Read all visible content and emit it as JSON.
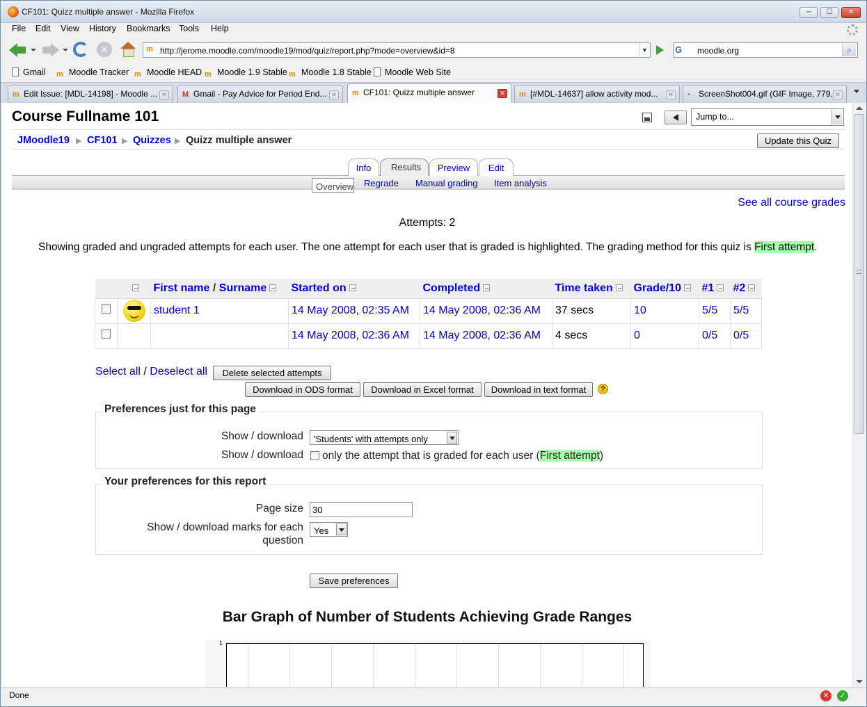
{
  "window": {
    "title": "CF101: Quizz multiple answer - Mozilla Firefox",
    "min": "─",
    "max": "☐",
    "close": "✕"
  },
  "menu": [
    "File",
    "Edit",
    "View",
    "History",
    "Bookmarks",
    "Tools",
    "Help"
  ],
  "nav": {
    "url": "http://jerome.moodle.com/moodle19/mod/quiz/report.php?mode=overview&id=8",
    "search_engine": "G",
    "search_value": "moodle.org"
  },
  "bookmarks": [
    "Gmail",
    "Moodle Tracker",
    "Moodle HEAD",
    "Moodle 1.9 Stable",
    "Moodle 1.8 Stable",
    "Moodle Web Site"
  ],
  "tabs": [
    {
      "label": "Edit Issue: [MDL-14198] - Moodle ..."
    },
    {
      "label": "Gmail - Pay Advice for Period End..."
    },
    {
      "label": "CF101: Quizz multiple answer"
    },
    {
      "label": "[#MDL-14637] allow activity mod..."
    },
    {
      "label": "ScreenShot004.gif (GIF Image, 779..."
    }
  ],
  "page": {
    "course_title": "Course Fullname 101",
    "jump_to": "Jump to...",
    "breadcrumb": [
      "JMoodle19",
      "CF101",
      "Quizzes",
      "Quizz multiple answer"
    ],
    "update_button": "Update this Quiz",
    "tabs": [
      "Info",
      "Results",
      "Preview",
      "Edit"
    ],
    "subtabs": [
      "Overview",
      "Regrade",
      "Manual grading",
      "Item analysis"
    ],
    "see_all": "See all course grades",
    "attempts": "Attempts: 2",
    "info_text": "Showing graded and ungraded attempts for each user. The one attempt for each user that is graded is highlighted. The grading method for this quiz is ",
    "grading_method": "First attempt",
    "info_end": "."
  },
  "table": {
    "headers": {
      "name_first": "First name",
      "name_sep": " / ",
      "name_last": "Surname",
      "started": "Started on",
      "completed": "Completed",
      "time": "Time taken",
      "grade": "Grade/10",
      "q1": "#1",
      "q2": "#2"
    },
    "rows": [
      {
        "name": "student 1",
        "started": "14 May 2008, 02:35 AM",
        "completed": "14 May 2008, 02:36 AM",
        "time": "37 secs",
        "grade": "10",
        "q1": "5/5",
        "q2": "5/5"
      },
      {
        "name": "",
        "started": "14 May 2008, 02:36 AM",
        "completed": "14 May 2008, 02:36 AM",
        "time": "4 secs",
        "grade": "0",
        "q1": "0/5",
        "q2": "0/5"
      }
    ]
  },
  "actions": {
    "select_all": "Select all",
    "slash": " / ",
    "deselect_all": "Deselect all",
    "delete": "Delete selected attempts",
    "ods": "Download in ODS format",
    "excel": "Download in Excel format",
    "text": "Download in text format",
    "help": "?"
  },
  "prefs_page": {
    "legend": "Preferences just for this page",
    "show_label_1": "Show / download",
    "show_select": "'Students' with attempts only",
    "show_label_2": "Show / download",
    "graded_only_text": "only the attempt that is graded for each user (",
    "graded_method": "First attempt",
    "graded_close": ")"
  },
  "prefs_report": {
    "legend": "Your preferences for this report",
    "page_size_label": "Page size",
    "page_size_value": "30",
    "marks_label_1": "Show / download marks for each",
    "marks_label_2": "question",
    "marks_value": "Yes",
    "save": "Save preferences"
  },
  "graph": {
    "title": "Bar Graph of Number of Students Achieving Grade Ranges",
    "y_tick": "1"
  },
  "status": {
    "text": "Done"
  }
}
